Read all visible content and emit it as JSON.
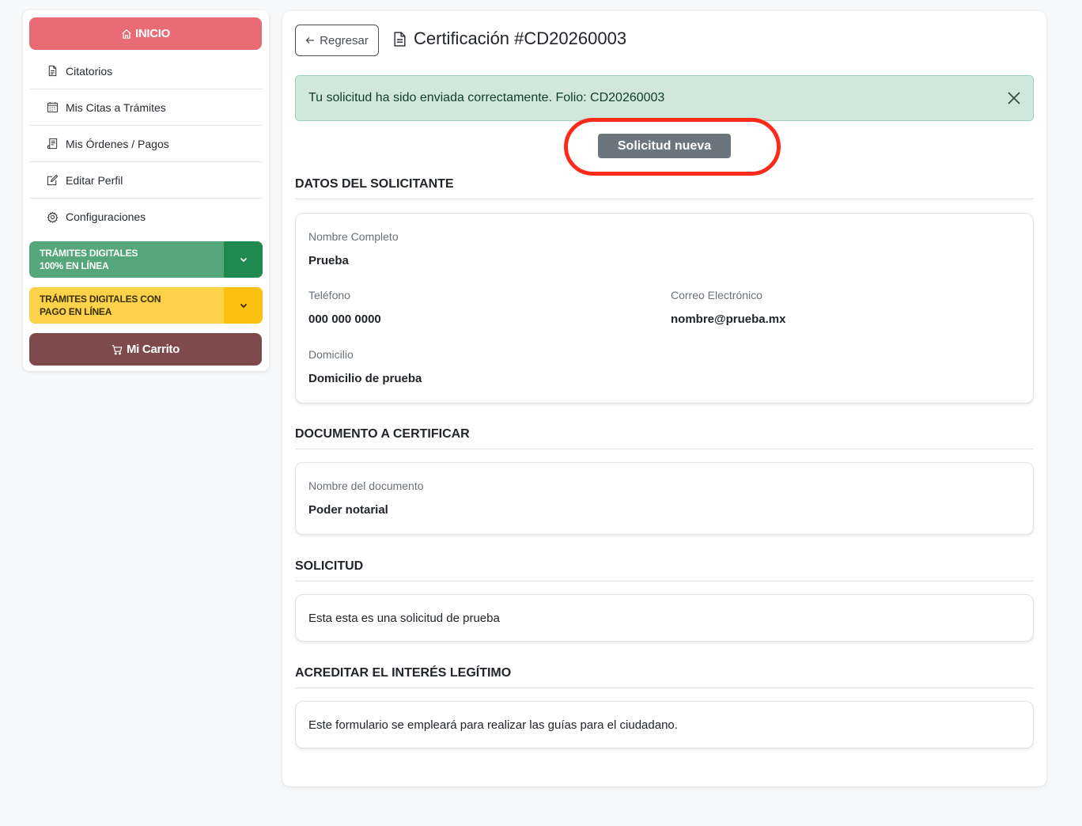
{
  "sidebar": {
    "home_label": "INICIO",
    "menu": [
      {
        "label": "Citatorios",
        "icon": "document-icon"
      },
      {
        "label": "Mis Citas a Trámites",
        "icon": "calendar-icon"
      },
      {
        "label": "Mis Órdenes / Pagos",
        "icon": "receipt-icon"
      },
      {
        "label": "Editar Perfil",
        "icon": "edit-icon"
      },
      {
        "label": "Configuraciones",
        "icon": "gear-icon"
      }
    ],
    "tramites_online": {
      "line1": "TRÁMITES DIGITALES",
      "line2": "100% EN LÍNEA"
    },
    "tramites_pago": {
      "line1": "TRÁMITES DIGITALES CON",
      "line2": "PAGO EN LÍNEA"
    },
    "cart_label": "Mi Carrito"
  },
  "header": {
    "back_label": "Regresar",
    "title": "Certificación #CD20260003"
  },
  "alert": {
    "message": "Tu solicitud ha sido enviada correctamente. Folio: CD20260003"
  },
  "status": {
    "label": "Solicitud nueva"
  },
  "solicitante": {
    "section_title": "DATOS DEL SOLICITANTE",
    "nombre_label": "Nombre Completo",
    "nombre_value": "Prueba",
    "telefono_label": "Teléfono",
    "telefono_value": "000 000 0000",
    "correo_label": "Correo Electrónico",
    "correo_value": "nombre@prueba.mx",
    "domicilio_label": "Domicilio",
    "domicilio_value": "Domicilio de prueba"
  },
  "documento": {
    "section_title": "DOCUMENTO A CERTIFICAR",
    "nombre_label": "Nombre del documento",
    "nombre_value": "Poder notarial"
  },
  "solicitud": {
    "section_title": "SOLICITUD",
    "text": "Esta esta es una solicitud de prueba"
  },
  "interes": {
    "section_title": "ACREDITAR EL INTERÉS LEGÍTIMO",
    "text": "Este formulario se empleará para realizar las guías para el ciudadano."
  },
  "colors": {
    "inicio": "#e86b76",
    "tramites_green": "#55a67a",
    "tramites_yellow": "#fcd24b",
    "cart": "#7f4a4b",
    "alert_bg": "#d1e7dd",
    "badge": "#6c757d",
    "highlight": "#ff2a1a"
  }
}
